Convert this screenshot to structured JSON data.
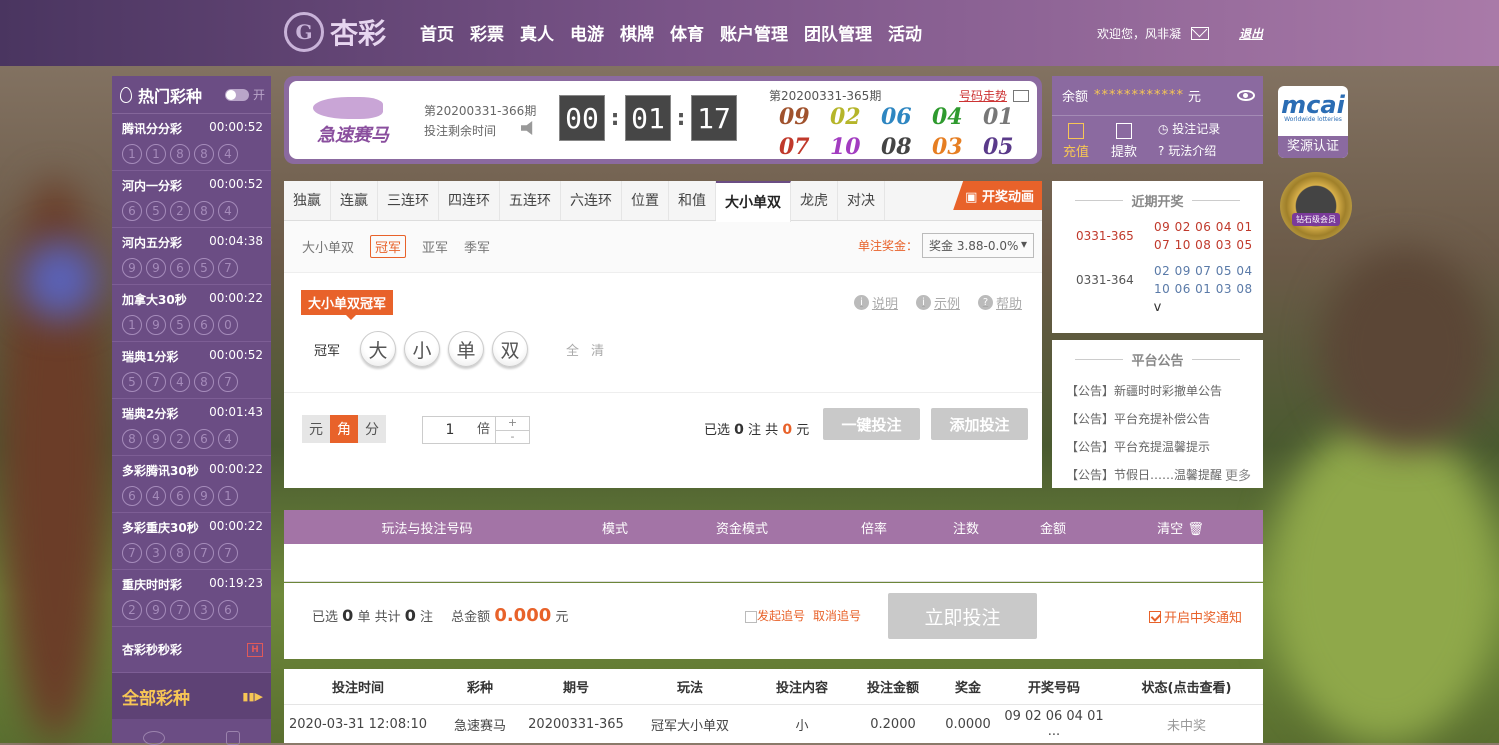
{
  "brand": {
    "name": "杏彩",
    "logo_glyph": "G"
  },
  "nav": [
    "首页",
    "彩票",
    "真人",
    "电游",
    "棋牌",
    "体育",
    "账户管理",
    "团队管理",
    "活动"
  ],
  "user": {
    "welcome": "欢迎您，风非凝",
    "logout": "退出"
  },
  "sidebar": {
    "title": "热门彩种",
    "toggle_label": "开",
    "items": [
      {
        "name": "腾讯分分彩",
        "time": "00:00:52",
        "balls": [
          "1",
          "1",
          "8",
          "8",
          "4"
        ]
      },
      {
        "name": "河内一分彩",
        "time": "00:00:52",
        "balls": [
          "6",
          "5",
          "2",
          "8",
          "4"
        ]
      },
      {
        "name": "河内五分彩",
        "time": "00:04:38",
        "balls": [
          "9",
          "9",
          "6",
          "5",
          "7"
        ]
      },
      {
        "name": "加拿大30秒",
        "time": "00:00:22",
        "balls": [
          "1",
          "9",
          "5",
          "6",
          "0"
        ]
      },
      {
        "name": "瑞典1分彩",
        "time": "00:00:52",
        "balls": [
          "5",
          "7",
          "4",
          "8",
          "7"
        ]
      },
      {
        "name": "瑞典2分彩",
        "time": "00:01:43",
        "balls": [
          "8",
          "9",
          "2",
          "6",
          "4"
        ]
      },
      {
        "name": "多彩腾讯30秒",
        "time": "00:00:22",
        "balls": [
          "6",
          "4",
          "6",
          "9",
          "1"
        ]
      },
      {
        "name": "多彩重庆30秒",
        "time": "00:00:22",
        "balls": [
          "7",
          "3",
          "8",
          "7",
          "7"
        ]
      },
      {
        "name": "重庆时时彩",
        "time": "00:19:23",
        "balls": [
          "2",
          "9",
          "7",
          "3",
          "6"
        ]
      }
    ],
    "last_item": "杏彩秒秒彩",
    "last_badge": "H",
    "all_label": "全部彩种",
    "all_arrow": "▮▮▶"
  },
  "lottery": {
    "logo_text": "急速赛马",
    "current_period": "第20200331-366期",
    "remaining_label": "投注剩余时间",
    "clock": [
      "00",
      "01",
      "17"
    ],
    "last_period": "第20200331-365期",
    "trend_label": "号码走势",
    "results": [
      "09",
      "02",
      "06",
      "04",
      "01",
      "07",
      "10",
      "08",
      "03",
      "05"
    ],
    "result_colors": [
      "#a0522d",
      "#b5b52a",
      "#2e86c1",
      "#2e9a2e",
      "#777777",
      "#c0392b",
      "#a23cc0",
      "#444444",
      "#e67e22",
      "#5a3a8a"
    ]
  },
  "balance": {
    "label": "余额",
    "masked": "************",
    "unit": "元",
    "deposit": "充值",
    "withdraw": "提款",
    "bet_record": "投注记录",
    "play_intro": "玩法介绍"
  },
  "badges": {
    "mcai_title": "mcai",
    "mcai_sub": "Worldwide lotteries",
    "mcai_caption": "奖源认证",
    "diamond_label": "钻石级会员"
  },
  "play": {
    "tabs": [
      "独赢",
      "连赢",
      "三连环",
      "四连环",
      "五连环",
      "六连环",
      "位置",
      "和值",
      "大小单双",
      "龙虎",
      "对决"
    ],
    "active_tab": "大小单双",
    "anim_button": "开奖动画",
    "subtabs": [
      "大小单双",
      "冠军",
      "亚军",
      "季军"
    ],
    "active_subtab": "冠军",
    "prize_label": "单注奖金：",
    "prize_value": "奖金 3.88-0.0%",
    "tag": "大小单双冠军",
    "helps": [
      "说明",
      "示例",
      "帮助"
    ],
    "row_label": "冠军",
    "choices": [
      "大",
      "小",
      "单",
      "双"
    ],
    "quick": "全清",
    "units": [
      "元",
      "角",
      "分"
    ],
    "active_unit": "角",
    "multiplier": "1",
    "mult_unit": "倍",
    "summary": {
      "prefix": "已选",
      "count": "0",
      "mid": "注  共",
      "amount": "0",
      "suffix": "元"
    },
    "one_click": "一键投注",
    "add_bet": "添加投注"
  },
  "latest": {
    "title": "近期开奖",
    "rows": [
      {
        "period": "0331-365",
        "line1": "09 02 06 04 01",
        "line2": "07 10 08 03 05",
        "highlight": true
      },
      {
        "period": "0331-364",
        "line1": "02 09 07 05 04",
        "line2": "10 06 01 03 08",
        "highlight": false
      }
    ],
    "expand": "v"
  },
  "notice": {
    "title": "平台公告",
    "items": [
      "【公告】新疆时时彩撤单公告",
      "【公告】平台充提补偿公告",
      "【公告】平台充提温馨提示",
      "【公告】节假日……温馨提醒"
    ],
    "more": "更多"
  },
  "bet_table": {
    "headers": [
      "玩法与投注号码",
      "模式",
      "资金模式",
      "倍率",
      "注数",
      "金额",
      "清空"
    ],
    "footer": {
      "sel_prefix": "已选",
      "sel_count": "0",
      "sel_mid": "单 共计",
      "total_count": "0",
      "sel_unit": "注",
      "total_label": "总金额",
      "total": "0.000",
      "total_unit": "元"
    },
    "chase": "发起追号",
    "cancel_chase": "取消追号",
    "submit": "立即投注",
    "notify": "开启中奖通知"
  },
  "records": {
    "headers": [
      "投注时间",
      "彩种",
      "期号",
      "玩法",
      "投注内容",
      "投注金额",
      "奖金",
      "开奖号码",
      "状态(点击查看)"
    ],
    "rows": [
      [
        "2020-03-31 12:08:10",
        "急速赛马",
        "20200331-365",
        "冠军大小单双",
        "小",
        "0.2000",
        "0.0000",
        "09 02 06 04 01 ...",
        "未中奖"
      ]
    ]
  }
}
